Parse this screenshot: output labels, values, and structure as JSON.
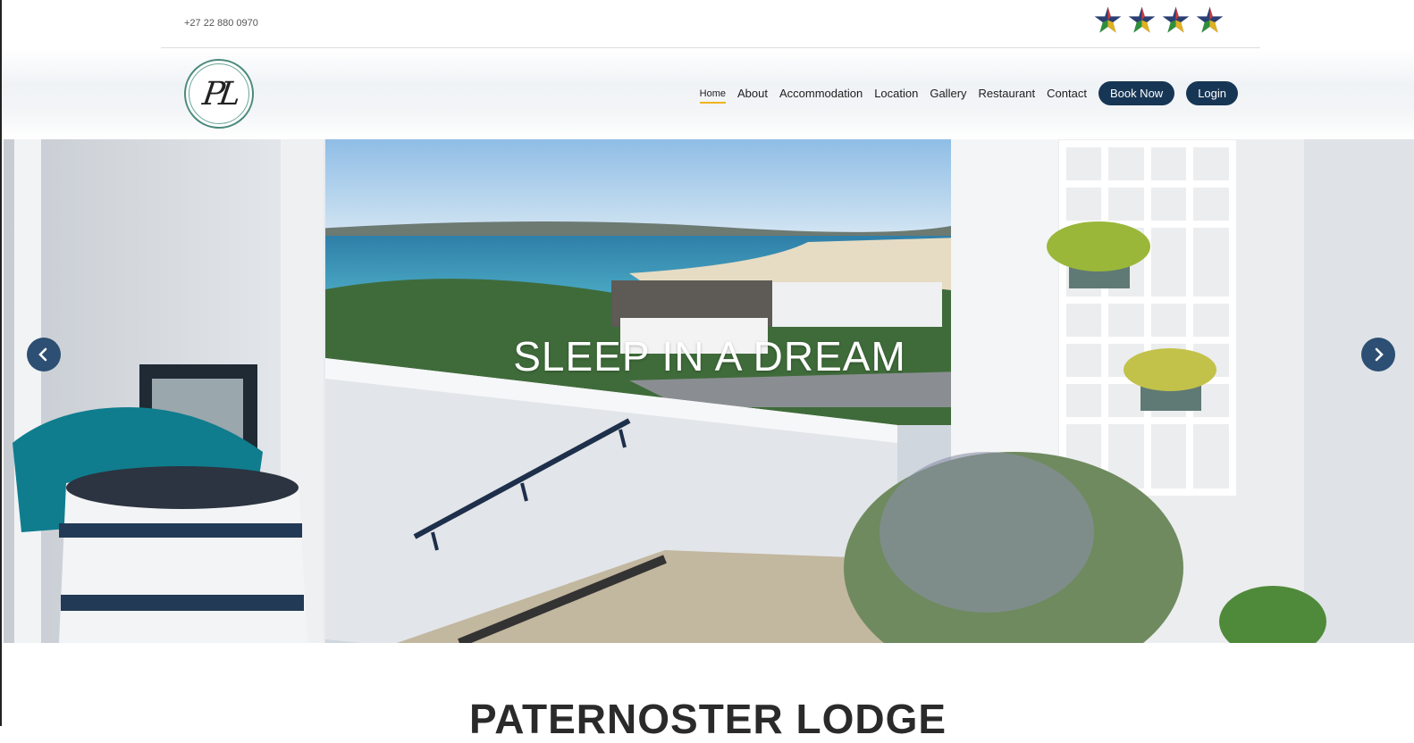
{
  "topbar": {
    "phone": "+27 22 880 0970",
    "stars": [
      "star-icon",
      "star-icon",
      "star-icon",
      "star-icon"
    ]
  },
  "logo": {
    "text": "PL"
  },
  "nav": {
    "items": [
      "Home",
      "About",
      "Accommodation",
      "Location",
      "Gallery",
      "Restaurant",
      "Contact"
    ],
    "active": "Home",
    "book_now": "Book Now",
    "login": "Login"
  },
  "hero": {
    "title": "SLEEP IN A DREAM",
    "prev_icon": "chevron-left-icon",
    "next_icon": "chevron-right-icon"
  },
  "section": {
    "title": "PATERNOSTER LODGE"
  },
  "colors": {
    "brand": "#173655",
    "active_underline": "#f0b323",
    "logo_ring": "#4a8a7c"
  }
}
